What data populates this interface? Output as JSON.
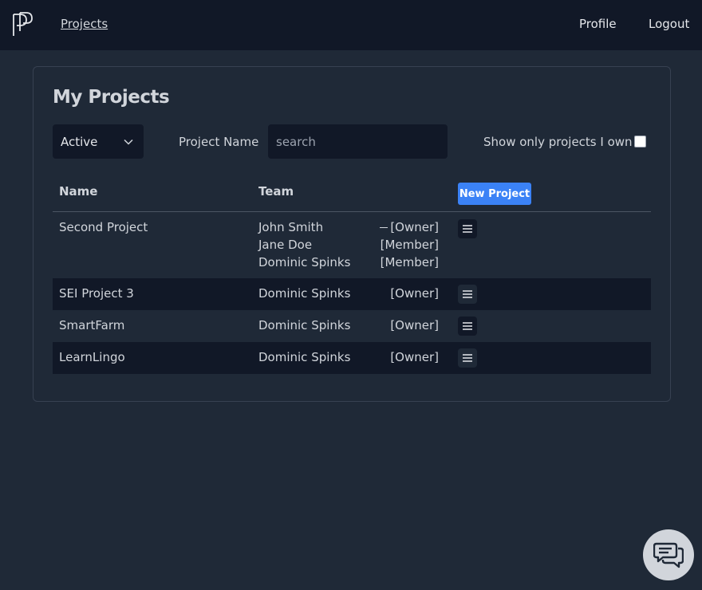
{
  "nav": {
    "projects": "Projects",
    "profile": "Profile",
    "logout": "Logout"
  },
  "page": {
    "title": "My Projects"
  },
  "filters": {
    "status_value": "Active",
    "project_name_label": "Project Name",
    "search_placeholder": "search",
    "search_value": "",
    "own_label": "Show only projects I own",
    "own_checked": false
  },
  "table": {
    "headers": {
      "name": "Name",
      "team": "Team"
    },
    "new_project_label": "New Project",
    "rows": [
      {
        "name": "Second Project",
        "members": [
          {
            "name": "John Smith",
            "role": "[Owner]"
          },
          {
            "name": "Jane Doe",
            "role": "[Member]"
          },
          {
            "name": "Dominic Spinks",
            "role": "[Member]"
          }
        ]
      },
      {
        "name": "SEI Project 3",
        "members": [
          {
            "name": "Dominic Spinks",
            "role": "[Owner]"
          }
        ]
      },
      {
        "name": "SmartFarm",
        "members": [
          {
            "name": "Dominic Spinks",
            "role": "[Owner]"
          }
        ]
      },
      {
        "name": "LearnLingo",
        "members": [
          {
            "name": "Dominic Spinks",
            "role": "[Owner]"
          }
        ]
      }
    ]
  },
  "icons": {
    "logo": "app-logo-icon",
    "chevron": "chevron-down-icon",
    "menu": "menu-icon",
    "chat": "chat-support-icon"
  },
  "colors": {
    "background": "#1f2937",
    "topbar": "#111827",
    "accent": "#3b82f6"
  }
}
